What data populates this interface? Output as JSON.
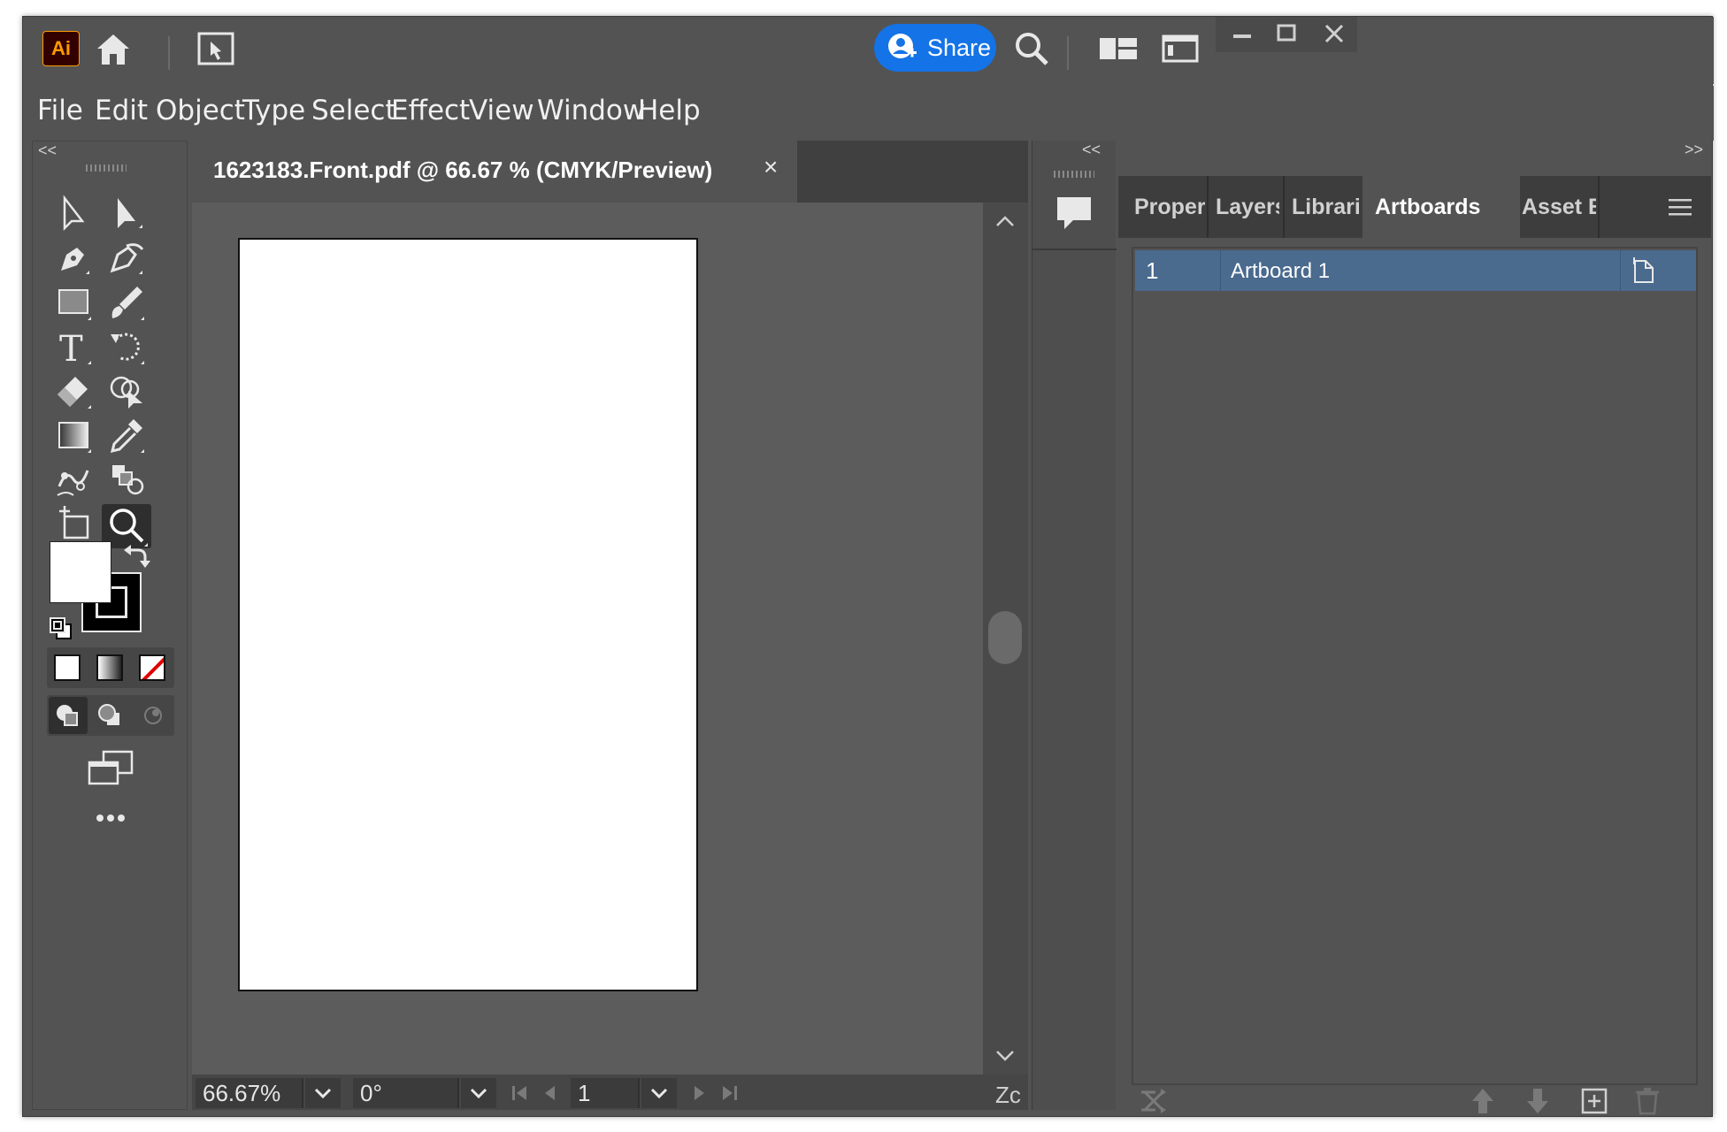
{
  "app": {
    "logo_text": "Ai",
    "share_label": "Share"
  },
  "menu": [
    "File",
    "Edit",
    "Object",
    "Type",
    "Select",
    "Effect",
    "View",
    "Window",
    "Help"
  ],
  "document": {
    "tab_title": "1623183.Front.pdf @ 66.67 % (CMYK/Preview)",
    "close_glyph": "×"
  },
  "status": {
    "zoom": "66.67%",
    "rotation": "0°",
    "artboard_number": "1",
    "zoom_label_partial": "Zc"
  },
  "panel": {
    "tabs": [
      "Proper",
      "Layers",
      "Librari",
      "Artboards",
      "Asset E"
    ],
    "active_tab": "Artboards",
    "artboards": [
      {
        "index": "1",
        "name": "Artboard 1"
      }
    ]
  },
  "collapse": {
    "left": "<<",
    "strip": "<<",
    "right": ">>"
  },
  "colors": {
    "ui_bg": "#535353",
    "share_blue": "#1473e6",
    "selected_row": "#4a6a8e",
    "logo_bg": "#330000",
    "logo_fg": "#ff9a00"
  }
}
